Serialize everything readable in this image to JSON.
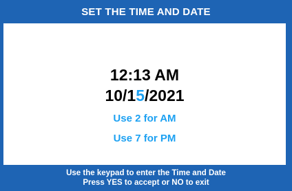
{
  "header": {
    "title": "SET THE TIME AND DATE"
  },
  "main": {
    "time": "12:13 AM",
    "date": {
      "before_cursor": "10/1",
      "cursor_digit": "5",
      "after_cursor": "/2021"
    },
    "hint_am": "Use 2 for AM",
    "hint_pm": "Use 7 for PM"
  },
  "footer": {
    "line1": "Use the keypad to enter the Time and Date",
    "line2": "Press YES to accept or NO to exit"
  },
  "colors": {
    "frame": "#1e64b4",
    "accent": "#1da1f2",
    "background": "#ffffff",
    "text": "#000000"
  }
}
